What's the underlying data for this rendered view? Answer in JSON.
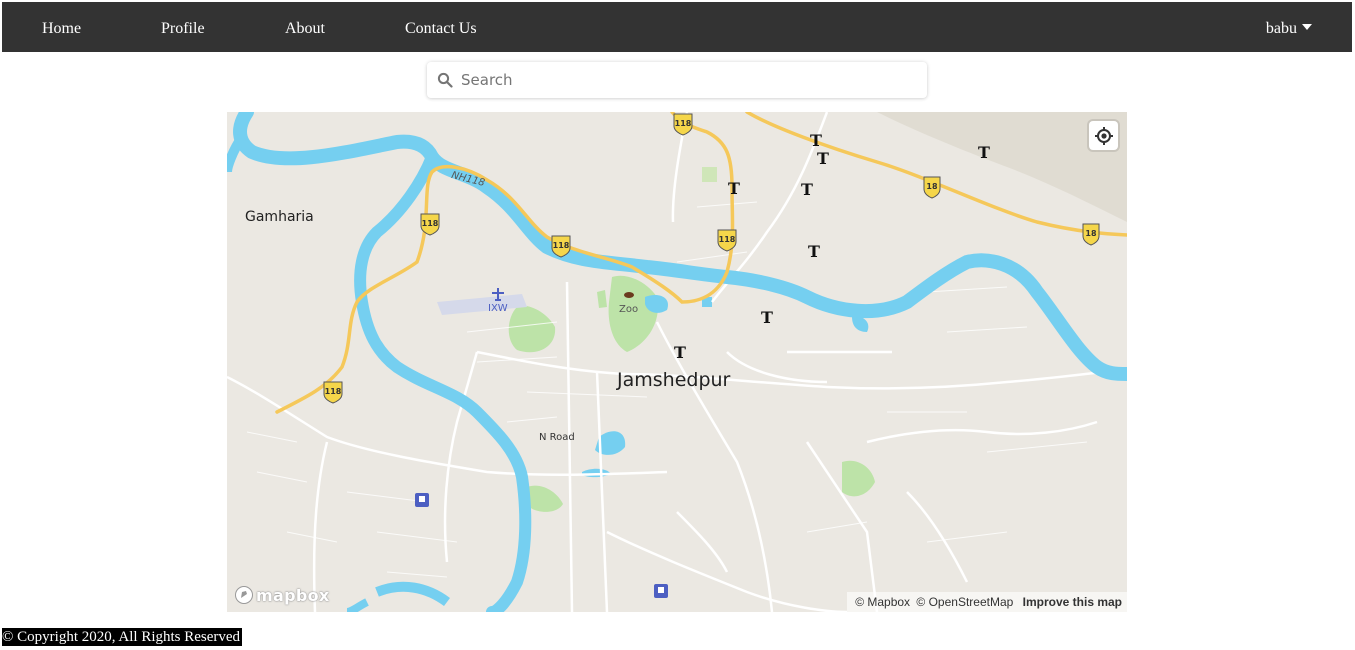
{
  "nav": {
    "items": [
      {
        "label": "Home"
      },
      {
        "label": "Profile"
      },
      {
        "label": "About"
      },
      {
        "label": "Contact Us"
      }
    ],
    "user": "babu"
  },
  "search": {
    "placeholder": "Search"
  },
  "map": {
    "labels": {
      "city": "Jamshedpur",
      "gamharia": "Gamharia",
      "zoo": "Zoo",
      "airport": "IXW",
      "nroad": "N Road",
      "nh118": "NH118"
    },
    "shields": [
      "118",
      "118",
      "118",
      "118",
      "118",
      "18",
      "18"
    ],
    "attribution": {
      "mapbox": "© Mapbox",
      "osm": "© OpenStreetMap",
      "improve": "Improve this map"
    },
    "logo": "mapbox",
    "colors": {
      "water": "#75cff0",
      "park": "#bde3a8",
      "highway": "#f5c85a",
      "land": "#ebe8e2"
    }
  },
  "footer": {
    "text": "© Copyright 2020, All Rights Reserved"
  }
}
